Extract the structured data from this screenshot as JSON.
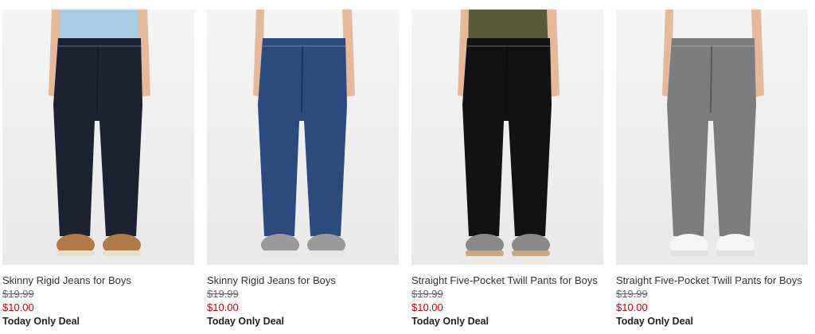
{
  "products": [
    {
      "name": "Skinny Rigid Jeans for Boys",
      "old_price": "$19.99",
      "price": "$10.00",
      "deal": "Today Only Deal",
      "pant_color": "#1d2233",
      "top_color": "#a9cde6",
      "shoe_color": "#b07b48",
      "shoe_sole": "#e8dfcf"
    },
    {
      "name": "Skinny Rigid Jeans for Boys",
      "old_price": "$19.99",
      "price": "$10.00",
      "deal": "Today Only Deal",
      "pant_color": "#2c4a7c",
      "top_color": "#f4f4f2",
      "shoe_color": "#9a9a9a",
      "shoe_sole": "#e6e6e6"
    },
    {
      "name": "Straight Five-Pocket Twill Pants for Boys",
      "old_price": "$19.99",
      "price": "$10.00",
      "deal": "Today Only Deal",
      "pant_color": "#121214",
      "top_color": "#5c5a3c",
      "shoe_color": "#8a8a88",
      "shoe_sole": "#c9a77f"
    },
    {
      "name": "Straight Five-Pocket Twill Pants for Boys",
      "old_price": "$19.99",
      "price": "$10.00",
      "deal": "Today Only Deal",
      "pant_color": "#7d7d80",
      "top_color": "#f2f2f2",
      "shoe_color": "#f5f5f5",
      "shoe_sole": "#e0e0e0"
    }
  ]
}
